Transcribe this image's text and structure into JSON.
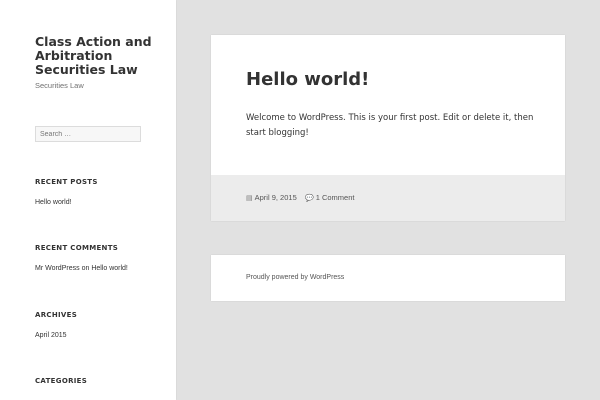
{
  "site": {
    "title": "Class Action and Arbitration Securities Law",
    "description": "Securities Law"
  },
  "search": {
    "placeholder": "Search …"
  },
  "widgets": {
    "recent_posts": {
      "title": "RECENT POSTS",
      "items": [
        "Hello world!"
      ]
    },
    "recent_comments": {
      "title": "RECENT COMMENTS",
      "author": "Mr WordPress",
      "on": "on",
      "post": "Hello world!"
    },
    "archives": {
      "title": "ARCHIVES",
      "items": [
        "April 2015"
      ]
    },
    "categories": {
      "title": "CATEGORIES"
    }
  },
  "post": {
    "title": "Hello world!",
    "body": "Welcome to WordPress. This is your first post. Edit or delete it, then start blogging!",
    "date": "April 9, 2015",
    "comments": "1 Comment"
  },
  "footer": {
    "powered": "Proudly powered by WordPress"
  },
  "colors": {
    "background": "#e1e1e1",
    "card": "#ffffff",
    "footer_bar": "#ececec"
  }
}
